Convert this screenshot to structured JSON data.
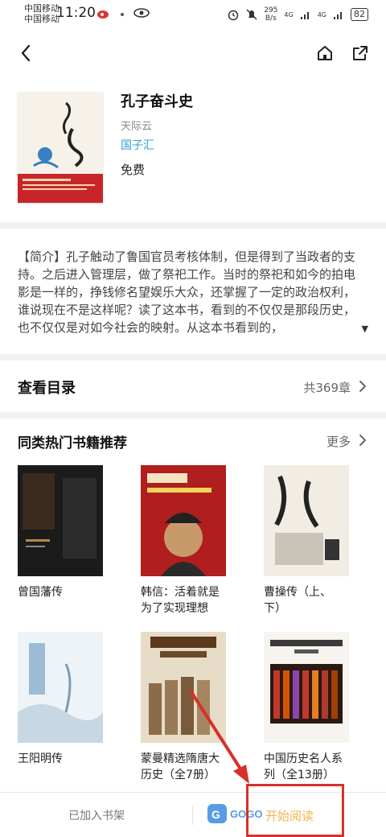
{
  "status_bar": {
    "carrier_1": "中国移动",
    "carrier_2": "中国移动",
    "time": "11:20",
    "net_speed": "295",
    "net_unit": "B/s",
    "signal_label": "4G",
    "battery": "82"
  },
  "book": {
    "title": "孔子奋斗史",
    "author": "天际云",
    "publisher": "国子汇",
    "price": "免费"
  },
  "intro": {
    "text": "【简介】孔子触动了鲁国官员考核体制，但是得到了当政者的支持。之后进入管理层，做了祭祀工作。当时的祭祀和如今的拍电影是一样的，挣钱修名望娱乐大众，还掌握了一定的政治权利，谁说现在不是这样呢？读了这本书，看到的不仅仅是那段历史，也不仅仅是对如今社会的映射。从这本书看到的，"
  },
  "toc": {
    "label": "查看目录",
    "count": "共369章"
  },
  "recommendations": {
    "title": "同类热门书籍推荐",
    "more": "更多",
    "books": [
      {
        "name": "曾国藩传"
      },
      {
        "name": "韩信：活着就是为了实现理想"
      },
      {
        "name": "曹操传（上、下）"
      },
      {
        "name": "王阳明传"
      },
      {
        "name": "蒙曼精选隋唐大历史（全7册）"
      },
      {
        "name": "中国历史名人系列（全13册）"
      }
    ]
  },
  "bottom_bar": {
    "added_label": "已加入书架",
    "read_label": "开始阅读"
  },
  "colors": {
    "accent_link": "#2e9fd6",
    "read_button": "#f0b64a",
    "annotation_red": "#d9302a"
  }
}
